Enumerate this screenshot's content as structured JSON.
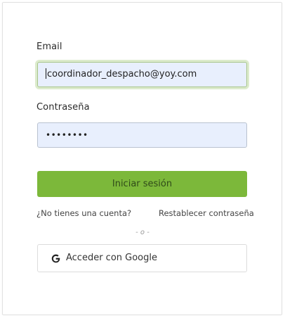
{
  "form": {
    "email_label": "Email",
    "email_value": "coordinador_despacho@yoy.com",
    "password_label": "Contraseña",
    "password_value": "••••••••",
    "login_button": "Iniciar sesión",
    "no_account_link": "¿No tienes una cuenta?",
    "reset_password_link": "Restablecer contraseña",
    "divider": "- o -",
    "google_button": "Acceder con Google",
    "google_icon": "google-g-icon"
  },
  "colors": {
    "accent_green": "#7cb83a",
    "input_background": "#e8effd",
    "focus_ring": "#dcebcd"
  }
}
